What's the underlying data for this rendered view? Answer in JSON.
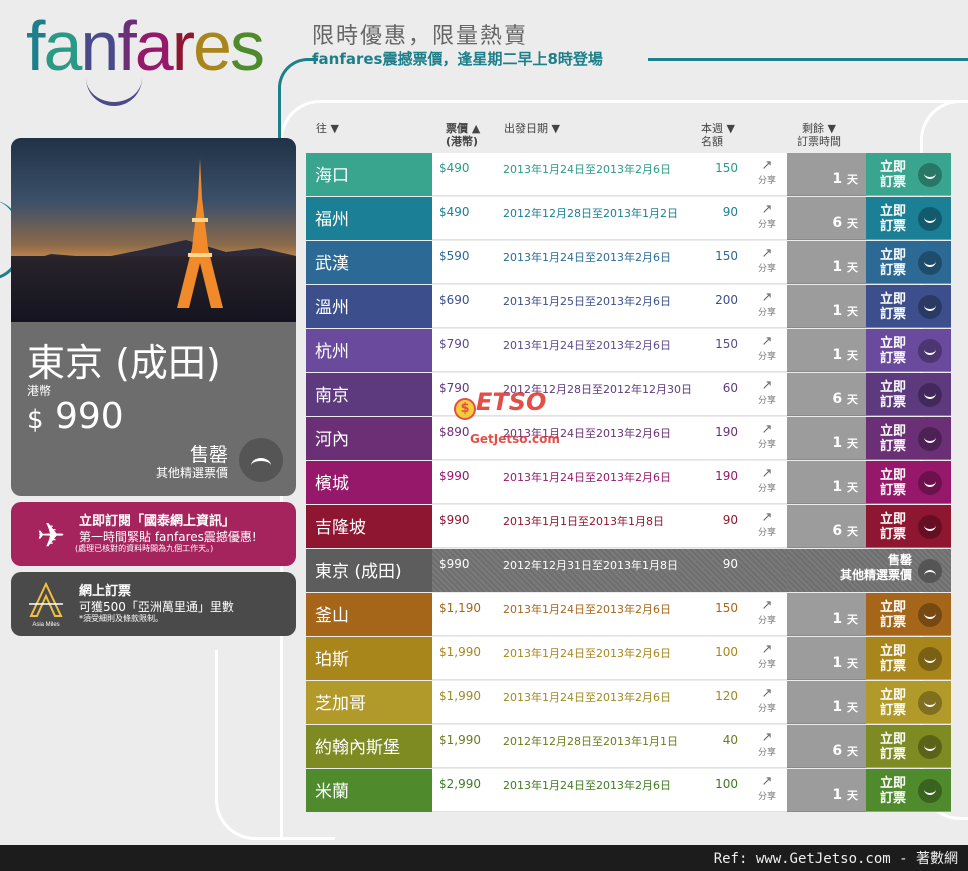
{
  "logo": {
    "text": "fanfares"
  },
  "header": {
    "tagline1": "限時優惠，限量熱賣",
    "tagline2": "fanfares震撼票價，逢星期二早上8時登場"
  },
  "featured": {
    "name": "東京 (成田)",
    "currency": "港幣",
    "price_symbol": "$",
    "price": "990",
    "sold_out": "售罄",
    "other_fares": "其他精選票價"
  },
  "promo1": {
    "line1": "立即訂閱「國泰網上資訊」",
    "line2": "第一時間緊貼 fanfares震撼優惠!",
    "line3": "(處理已核對的資料時間為九個工作天。)"
  },
  "promo2": {
    "logo_text": "Asia Miles",
    "line1": "網上訂票",
    "line2": "可獲500「亞洲萬里通」里數",
    "line3": "*須受細則及條款限制。"
  },
  "columns": {
    "dest": "往 ▼",
    "price": "票價 ▲",
    "price_sub": "(港幣)",
    "date": "出發日期 ▼",
    "seats": "本週 ▼",
    "seats_sub": "名額",
    "remain": "剩餘 ▼",
    "remain_sub": "訂票時間"
  },
  "share_label": "分享",
  "book_label": "立即訂票",
  "rows": [
    {
      "dest": "海口",
      "price": "$490",
      "date": "2013年1月24日至2013年2月6日",
      "seats": "150",
      "remain": "1",
      "unit": "天",
      "color": "#3aa58f",
      "text_color": "#2a9a86"
    },
    {
      "dest": "福州",
      "price": "$490",
      "date": "2012年12月28日至2013年1月2日",
      "seats": "90",
      "remain": "6",
      "unit": "天",
      "color": "#1b7f96",
      "text_color": "#1b7f96"
    },
    {
      "dest": "武漢",
      "price": "$590",
      "date": "2013年1月24日至2013年2月6日",
      "seats": "150",
      "remain": "1",
      "unit": "天",
      "color": "#2c6a95",
      "text_color": "#2c6a95"
    },
    {
      "dest": "溫州",
      "price": "$690",
      "date": "2013年1月25日至2013年2月6日",
      "seats": "200",
      "remain": "1",
      "unit": "天",
      "color": "#3c4f8c",
      "text_color": "#3c4f8c"
    },
    {
      "dest": "杭州",
      "price": "$790",
      "date": "2013年1月24日至2013年2月6日",
      "seats": "150",
      "remain": "1",
      "unit": "天",
      "color": "#6a4a9c",
      "text_color": "#5b4a8c"
    },
    {
      "dest": "南京",
      "price": "$790",
      "date": "2012年12月28日至2012年12月30日",
      "seats": "60",
      "remain": "6",
      "unit": "天",
      "color": "#5d3a7e",
      "text_color": "#5d3a7e"
    },
    {
      "dest": "河內",
      "price": "$890",
      "date": "2013年1月24日至2013年2月6日",
      "seats": "190",
      "remain": "1",
      "unit": "天",
      "color": "#6a2f75",
      "text_color": "#6a2f75"
    },
    {
      "dest": "檳城",
      "price": "$990",
      "date": "2013年1月24日至2013年2月6日",
      "seats": "190",
      "remain": "1",
      "unit": "天",
      "color": "#96186a",
      "text_color": "#96186a"
    },
    {
      "dest": "吉隆坡",
      "price": "$990",
      "date": "2013年1月1日至2013年1月8日",
      "seats": "90",
      "remain": "6",
      "unit": "天",
      "color": "#8e1630",
      "text_color": "#8e1630"
    },
    {
      "dest": "東京 (成田)",
      "price": "$990",
      "date": "2012年12月31日至2013年1月8日",
      "seats": "90",
      "sold": "售罄",
      "sold_sub": "其他精選票價",
      "color": "#5d5d5d",
      "text_color": "#fff"
    },
    {
      "dest": "釜山",
      "price": "$1,190",
      "date": "2013年1月24日至2013年2月6日",
      "seats": "150",
      "remain": "1",
      "unit": "天",
      "color": "#a5661a",
      "text_color": "#a5661a"
    },
    {
      "dest": "珀斯",
      "price": "$1,990",
      "date": "2013年1月24日至2013年2月6日",
      "seats": "100",
      "remain": "1",
      "unit": "天",
      "color": "#a8861c",
      "text_color": "#a8861c"
    },
    {
      "dest": "芝加哥",
      "price": "$1,990",
      "date": "2013年1月24日至2013年2月6日",
      "seats": "120",
      "remain": "1",
      "unit": "天",
      "color": "#b29a2a",
      "text_color": "#9c8a22"
    },
    {
      "dest": "約翰內斯堡",
      "price": "$1,990",
      "date": "2012年12月28日至2013年1月1日",
      "seats": "40",
      "remain": "6",
      "unit": "天",
      "color": "#7e8a22",
      "text_color": "#6e7a1e"
    },
    {
      "dest": "米蘭",
      "price": "$2,990",
      "date": "2013年1月24日至2013年2月6日",
      "seats": "100",
      "remain": "1",
      "unit": "天",
      "color": "#4f8a2c",
      "text_color": "#3f7a22"
    }
  ],
  "watermark": {
    "text": "ETSO",
    "sub": "GetJetso.com",
    "coin": "$"
  },
  "footer": {
    "text": "Ref: www.GetJetso.com - 著數網"
  }
}
